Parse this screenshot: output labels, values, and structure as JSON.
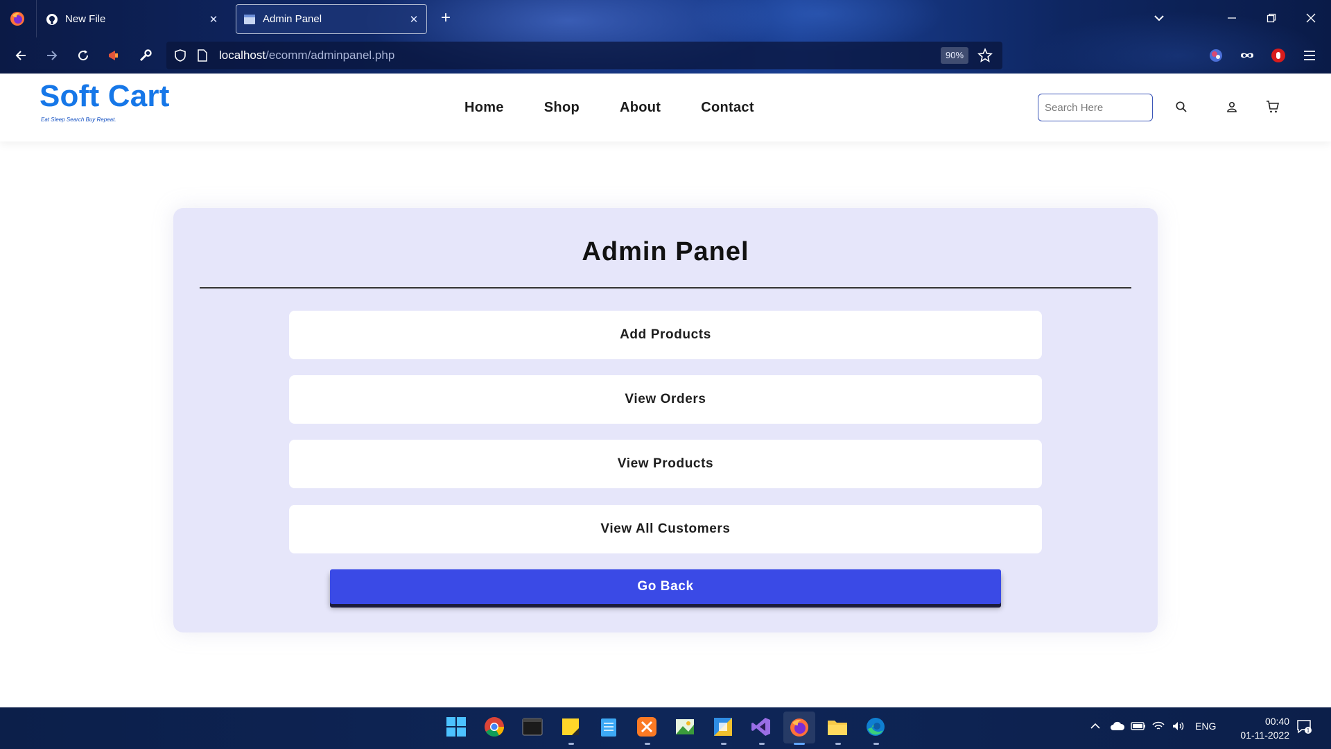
{
  "browser": {
    "tabs": [
      {
        "title": "New File",
        "active": false,
        "icon": "github-icon"
      },
      {
        "title": "Admin Panel",
        "active": true,
        "icon": "page-icon"
      }
    ],
    "url_host": "localhost",
    "url_path": "/ecomm/adminpanel.php",
    "zoom": "90%"
  },
  "site": {
    "brand": "Soft Cart",
    "tagline": "Eat Sleep Search Buy Repeat.",
    "nav": [
      "Home",
      "Shop",
      "About",
      "Contact"
    ],
    "search_placeholder": "Search Here",
    "brand_color": "#1677e8"
  },
  "admin": {
    "title": "Admin Panel",
    "actions": [
      "Add Products",
      "View Orders",
      "View Products",
      "View All Customers"
    ],
    "back_label": "Go Back",
    "card_color": "#e6e6fa",
    "button_color": "#3a4ae6"
  },
  "taskbar": {
    "apps": [
      "windows-start-icon",
      "chrome-icon",
      "terminal-icon",
      "sticky-notes-icon",
      "notepad-icon",
      "xampp-icon",
      "image-editor-icon",
      "app-icon",
      "visual-studio-icon",
      "firefox-icon",
      "file-explorer-icon",
      "edge-icon"
    ],
    "language": "ENG",
    "time": "00:40",
    "date": "01-11-2022",
    "notification_count": "1"
  }
}
